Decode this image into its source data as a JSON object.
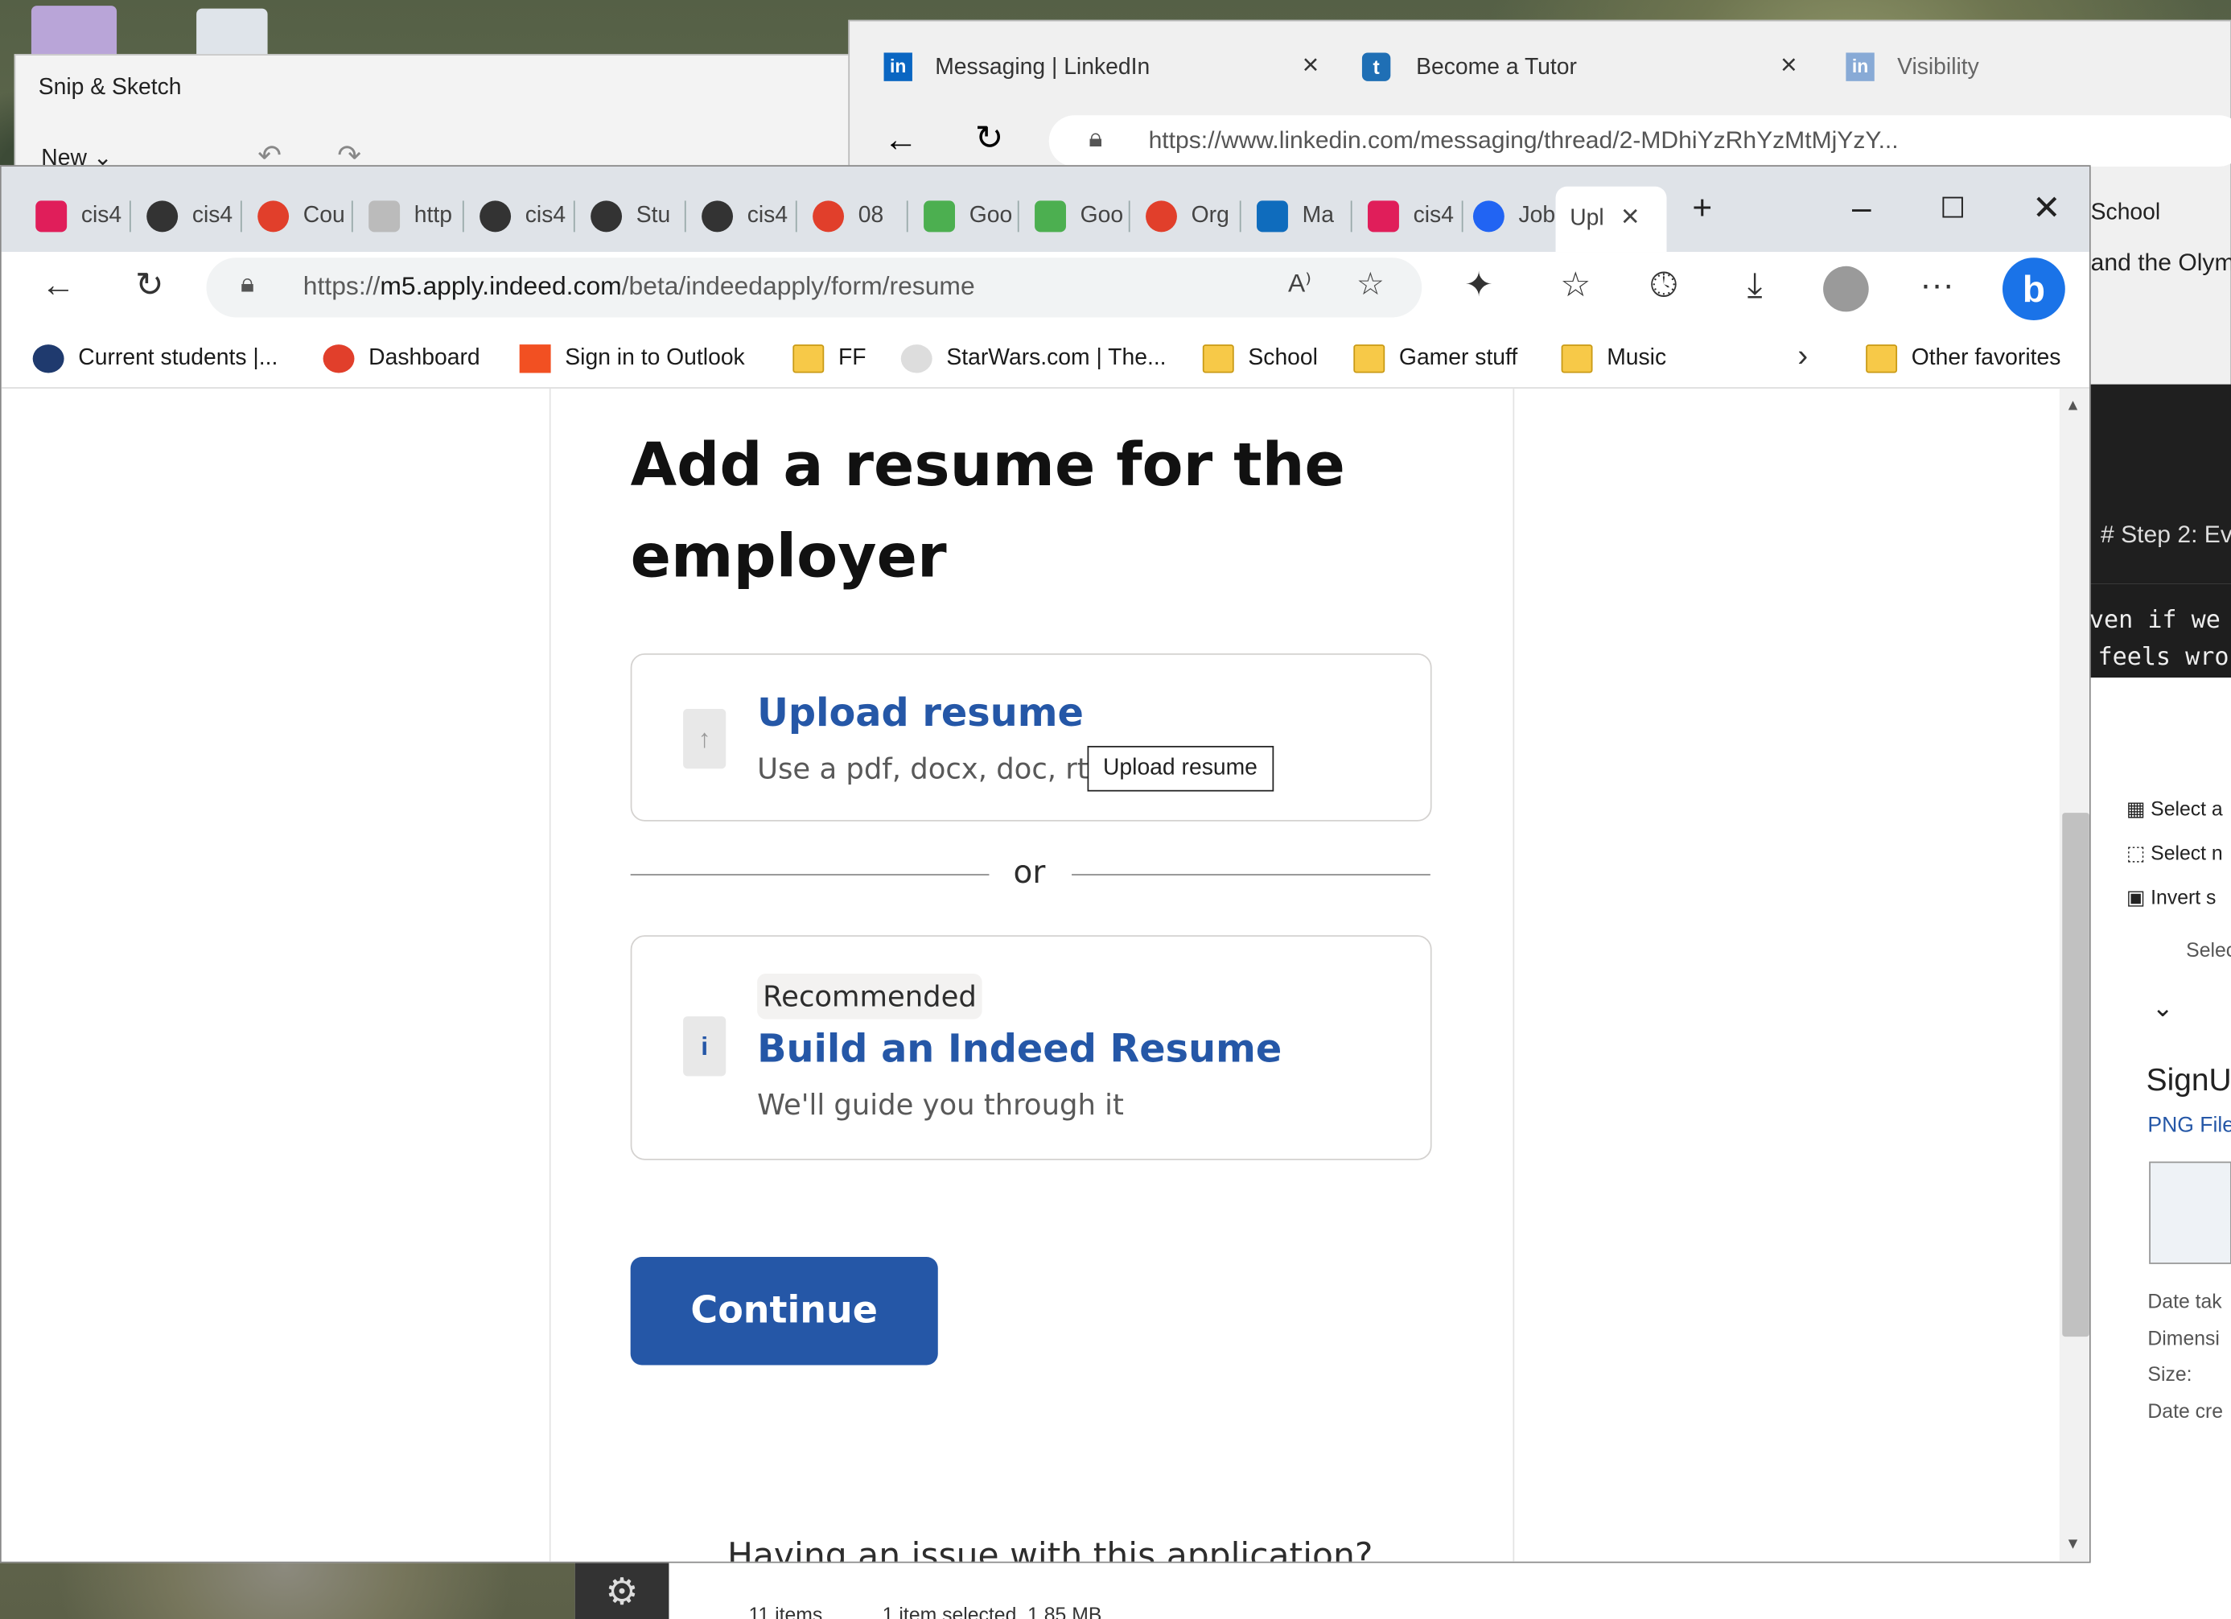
{
  "snip": {
    "title": "Snip & Sketch",
    "new_label": "New"
  },
  "linkedin_window": {
    "tabs": [
      {
        "label": "Messaging | LinkedIn"
      },
      {
        "label": "Become a Tutor"
      },
      {
        "label": "Visibility"
      }
    ],
    "url": "https://www.linkedin.com/messaging/thread/2-MDhiYzRhYzMtMjYzY...",
    "fav_partial": "School",
    "page_partial": "and the Olym"
  },
  "right_panel": {
    "step_text": "# Step 2: Ev",
    "code_line1": "ven if we",
    "code_line2": "feels wro",
    "select_all": "Select a",
    "select_none": "Select n",
    "invert": "Invert s",
    "group_label": "Selec",
    "file_name": "SignU",
    "file_type": "PNG File",
    "date_taken": "Date tak",
    "dimensions": "Dimensi",
    "size": "Size:",
    "date_created": "Date cre"
  },
  "main_window": {
    "tabs": [
      {
        "label": "cis4",
        "icon": "slack-icon"
      },
      {
        "label": "cis4",
        "icon": "github-icon"
      },
      {
        "label": "Cou",
        "icon": "canvas-icon"
      },
      {
        "label": "http",
        "icon": "page-icon"
      },
      {
        "label": "cis4",
        "icon": "github-icon"
      },
      {
        "label": "Stu",
        "icon": "github-icon"
      },
      {
        "label": "cis4",
        "icon": "github-icon"
      },
      {
        "label": "08",
        "icon": "canvas-icon"
      },
      {
        "label": "Goo",
        "icon": "google-icon"
      },
      {
        "label": "Goo",
        "icon": "google-icon"
      },
      {
        "label": "Org",
        "icon": "canvas-icon"
      },
      {
        "label": "Ma",
        "icon": "outlook-icon"
      },
      {
        "label": "cis4",
        "icon": "slack-icon"
      },
      {
        "label": "Job",
        "icon": "indeed-icon"
      },
      {
        "label": "Upl",
        "icon": "none"
      }
    ],
    "url_prefix": "https://",
    "url_host": "m5.apply.indeed.com",
    "url_path": "/beta/indeedapply/form/resume",
    "favorites": [
      {
        "label": "Current students |...",
        "icon": "university-icon"
      },
      {
        "label": "Dashboard",
        "icon": "canvas-icon"
      },
      {
        "label": "Sign in to Outlook",
        "icon": "microsoft-icon"
      },
      {
        "label": "FF",
        "icon": "folder-icon"
      },
      {
        "label": "StarWars.com | The...",
        "icon": "starwars-icon"
      },
      {
        "label": "School",
        "icon": "folder-icon"
      },
      {
        "label": "Gamer stuff",
        "icon": "folder-icon"
      },
      {
        "label": "Music",
        "icon": "folder-icon"
      }
    ],
    "other_favorites": "Other favorites"
  },
  "page": {
    "heading": "Add a resume for the employer",
    "upload_title": "Upload resume",
    "upload_sub": "Use a pdf, docx, doc, rtf",
    "tooltip": "Upload resume",
    "or": "or",
    "recommended": "Recommended",
    "build_title": "Build an Indeed Resume",
    "build_sub": "We'll guide you through it",
    "continue": "Continue",
    "issue": "Having an issue with this application?"
  },
  "explorer_status": {
    "items": "11 items",
    "selected": "1 item selected  1.85 MB"
  },
  "colors": {
    "indeed_blue": "#2557a7",
    "tab_bar": "#dfe3e8"
  }
}
